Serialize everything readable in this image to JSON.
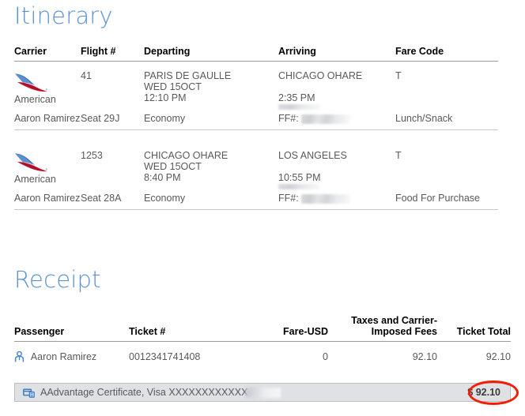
{
  "itinerary": {
    "heading": "Itinerary",
    "columns": [
      "Carrier",
      "Flight #",
      "Departing",
      "Arriving",
      "Fare Code"
    ],
    "segments": [
      {
        "carrier_logo": "american-airlines-logo",
        "carrier_name": "American",
        "flight_number": "41",
        "departing_city": "PARIS DE GAULLE",
        "departing_date": "WED 15OCT",
        "departing_time": "12:10 PM",
        "arriving_city": "CHICAGO OHARE",
        "arriving_date": "",
        "arriving_time": "2:35 PM",
        "fare_code": "T",
        "passenger": "Aaron Ramirez",
        "seat": "Seat 29J",
        "cabin": "Economy",
        "ff_label": "FF#:",
        "ff_number": "",
        "meal": "Lunch/Snack"
      },
      {
        "carrier_logo": "american-airlines-logo",
        "carrier_name": "American",
        "flight_number": "1253",
        "departing_city": "CHICAGO OHARE",
        "departing_date": "WED 15OCT",
        "departing_time": "8:40 PM",
        "arriving_city": "LOS ANGELES",
        "arriving_date": "",
        "arriving_time": "10:55 PM",
        "fare_code": "T",
        "passenger": "Aaron Ramirez",
        "seat": "Seat 28A",
        "cabin": "Economy",
        "ff_label": "FF#:",
        "ff_number": "",
        "meal": "Food For Purchase"
      }
    ]
  },
  "receipt": {
    "heading": "Receipt",
    "columns": {
      "passenger": "Passenger",
      "ticket": "Ticket #",
      "fare": "Fare-USD",
      "taxes_line1": "Taxes and Carrier-",
      "taxes_line2": "Imposed Fees",
      "total": "Ticket Total"
    },
    "rows": [
      {
        "passenger": "Aaron Ramirez",
        "ticket_number": "0012341741408",
        "fare": "0",
        "taxes": "92.10",
        "ticket_total": "92.10"
      }
    ],
    "payment": {
      "icon": "credit-card-icon",
      "description": "AAdvantage Certificate, Visa XXXXXXXXXXXX",
      "amount": "$ 92.10"
    }
  },
  "annotation": {
    "highlight_color": "#f01f06",
    "target": "ticket-total-amount"
  },
  "colors": {
    "heading_blue": "#5b92cf",
    "body_text": "#58595b",
    "header_text": "#000000",
    "rule": "#9a9a9a",
    "row_rule": "#c8c8c8",
    "payment_row_bg": "#dfe1e4",
    "annotation_red": "#f01f06"
  }
}
